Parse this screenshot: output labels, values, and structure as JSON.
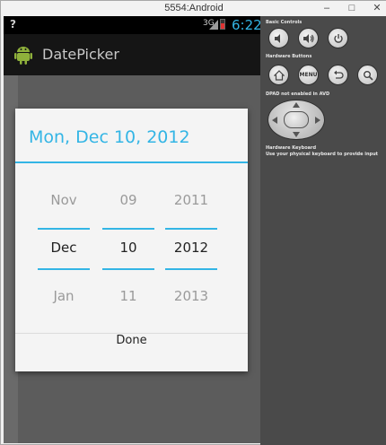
{
  "window": {
    "title": "5554:Android",
    "controls": {
      "minimize": "–",
      "maximize": "□",
      "close": "✕"
    }
  },
  "statusbar": {
    "question": "?",
    "network": "3G",
    "time": "6:22",
    "accent": "#33b5e5"
  },
  "actionbar": {
    "title": "DatePicker",
    "icon": "android-icon"
  },
  "dialog": {
    "title": "Mon, Dec 10, 2012",
    "month": {
      "prev": "Nov",
      "current": "Dec",
      "next": "Jan"
    },
    "day": {
      "prev": "09",
      "current": "10",
      "next": "11"
    },
    "year": {
      "prev": "2011",
      "current": "2012",
      "next": "2013"
    },
    "done_label": "Done"
  },
  "panel": {
    "basic_controls_label": "Basic Controls",
    "hardware_buttons_label": "Hardware Buttons",
    "menu_label": "MENU",
    "dpad_label": "DPAD not enabled in AVD",
    "hw_keyboard_label": "Hardware Keyboard",
    "hw_keyboard_hint": "Use your physical keyboard to provide input",
    "icons": [
      "volume-down-icon",
      "volume-up-icon",
      "power-icon",
      "home-icon",
      "menu-icon",
      "back-icon",
      "search-icon"
    ]
  }
}
